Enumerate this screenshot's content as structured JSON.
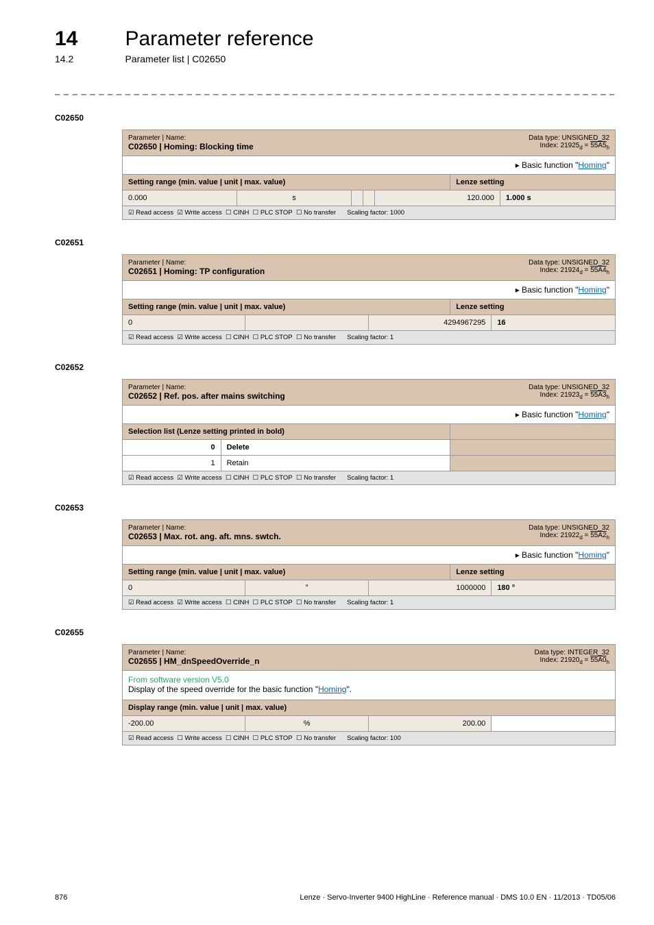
{
  "header": {
    "chapter_num": "14",
    "chapter_title": "Parameter reference",
    "subsec_num": "14.2",
    "subsec_title": "Parameter list | C02650",
    "dashes": "_ _ _ _ _ _ _ _ _ _ _ _ _ _ _ _ _ _ _ _ _ _ _ _ _ _ _ _ _ _ _ _ _ _ _ _ _ _ _ _ _ _ _ _ _ _ _ _ _ _ _ _ _ _ _ _ _ _ _ _ _ _ _ _"
  },
  "common": {
    "param_name_label": "Parameter | Name:",
    "basic_func_prefix": "▸ Basic function \"",
    "basic_func_link": "Homing",
    "basic_func_suffix": "\"",
    "setting_range_label": "Setting range (min. value | unit | max. value)",
    "display_range_label": "Display range (min. value | unit | max. value)",
    "lenze_setting_label": "Lenze setting",
    "selection_list_label": "Selection list (Lenze setting printed in bold)",
    "read_access": "☑ Read access",
    "write_access_on": "☑ Write access",
    "write_access_off": "☐ Write access",
    "cinh": "☐ CINH",
    "plcstop": "☐ PLC STOP",
    "notransfer": "☐ No transfer"
  },
  "c02650": {
    "anchor": "C02650",
    "name": "C02650 | Homing: Blocking time",
    "dt": "Data type: UNSIGNED_32",
    "idx_label": "Index: 21925",
    "idx_hex": "55A5",
    "min": "0.000",
    "unit": "s",
    "max": "120.000",
    "lenze": "1.000 s",
    "scaling": "Scaling factor: 1000"
  },
  "c02651": {
    "anchor": "C02651",
    "name": "C02651 | Homing: TP configuration",
    "dt": "Data type: UNSIGNED_32",
    "idx_label": "Index: 21924",
    "idx_hex": "55A4",
    "min": "0",
    "unit": "",
    "max": "4294967295",
    "lenze": "16",
    "scaling": "Scaling factor: 1"
  },
  "c02652": {
    "anchor": "C02652",
    "name": "C02652 | Ref. pos. after mains switching",
    "dt": "Data type: UNSIGNED_32",
    "idx_label": "Index: 21923",
    "idx_hex": "55A3",
    "opt0_num": "0",
    "opt0_txt": "Delete",
    "opt1_num": "1",
    "opt1_txt": "Retain",
    "scaling": "Scaling factor: 1"
  },
  "c02653": {
    "anchor": "C02653",
    "name": "C02653 | Max. rot. ang. aft. mns. swtch.",
    "dt": "Data type: UNSIGNED_32",
    "idx_label": "Index: 21922",
    "idx_hex": "55A2",
    "min": "0",
    "unit": "°",
    "max": "1000000",
    "lenze": "180 °",
    "scaling": "Scaling factor: 1"
  },
  "c02655": {
    "anchor": "C02655",
    "name": "C02655 | HM_dnSpeedOverride_n",
    "dt": "Data type: INTEGER_32",
    "idx_label": "Index: 21920",
    "idx_hex": "55A0",
    "from_sw": "From software version V5.0",
    "desc_prefix": "Display of the speed override for the basic function \"",
    "desc_link": "Homing",
    "desc_suffix": "\".",
    "min": "-200.00",
    "unit": "%",
    "max": "200.00",
    "scaling": "Scaling factor: 100"
  },
  "footer": {
    "page": "876",
    "info": "Lenze · Servo-Inverter 9400 HighLine · Reference manual · DMS 10.0 EN · 11/2013 · TD05/06"
  }
}
